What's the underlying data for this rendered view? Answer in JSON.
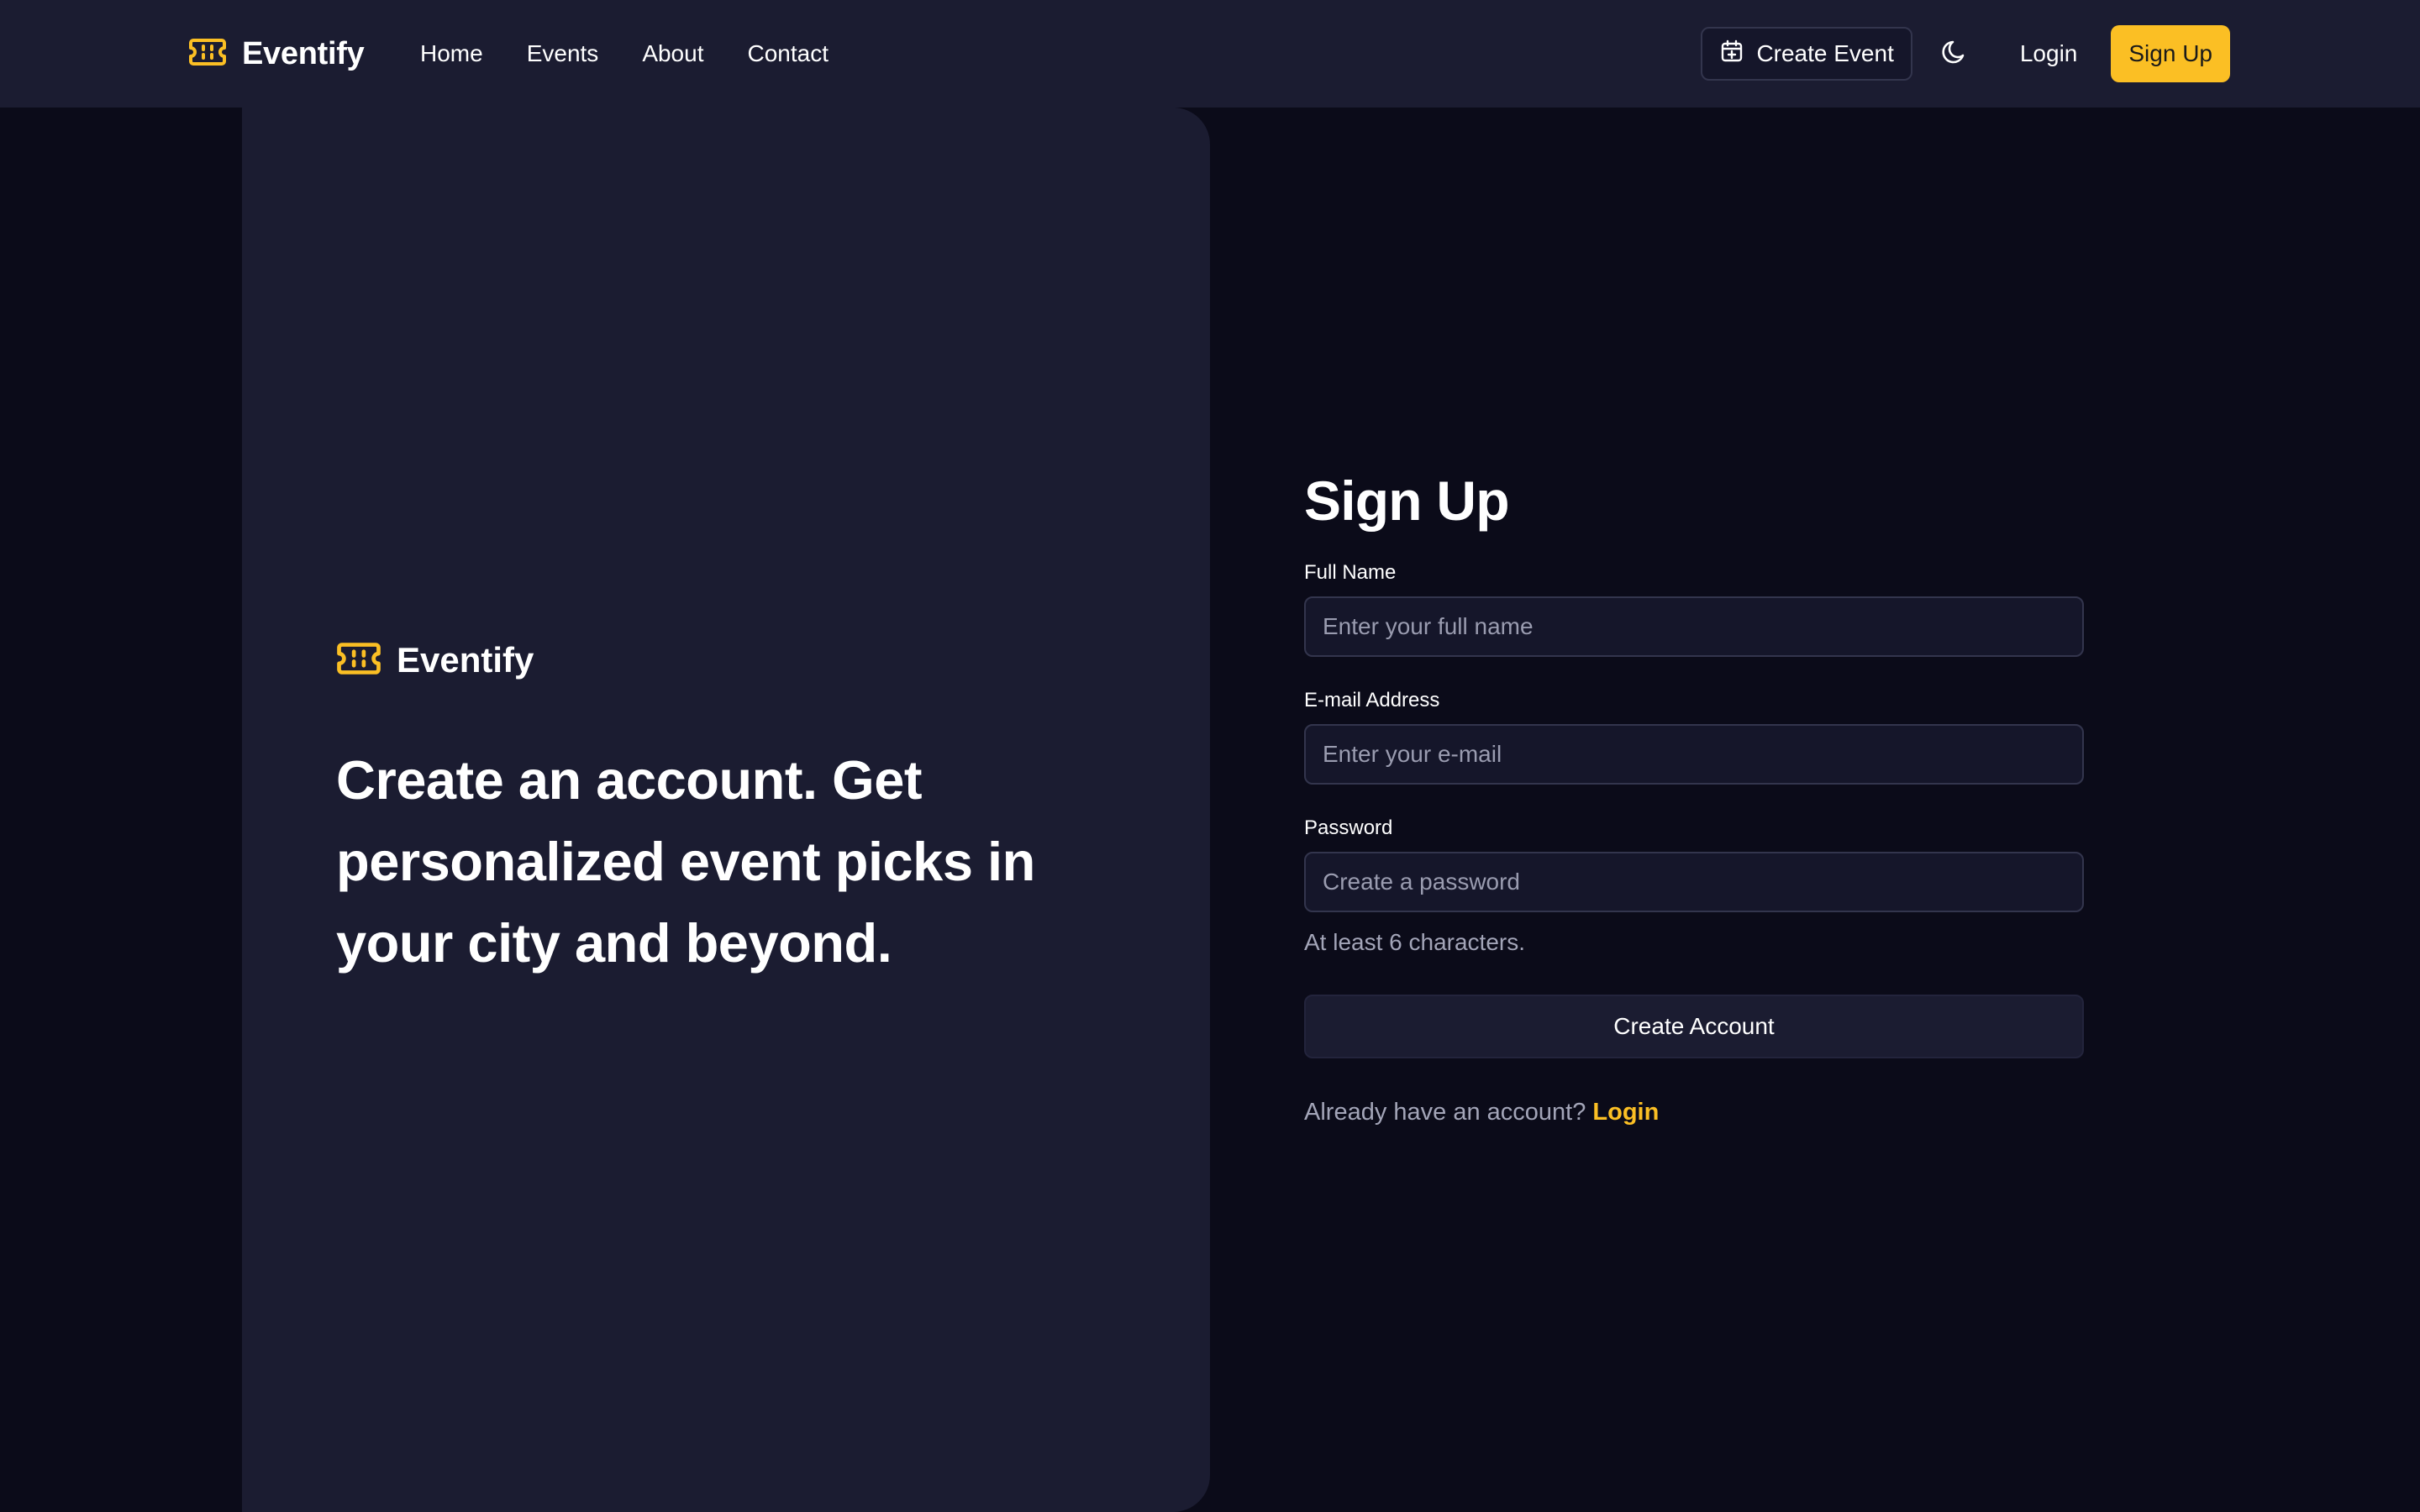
{
  "brand": {
    "name": "Eventify",
    "icon": "ticket-icon",
    "accent_color": "#fbbf24"
  },
  "nav": {
    "links": [
      "Home",
      "Events",
      "About",
      "Contact"
    ],
    "create_event_label": "Create Event",
    "create_event_icon": "calendar-plus-icon",
    "theme_toggle_icon": "moon-icon",
    "login_label": "Login",
    "signup_label": "Sign Up"
  },
  "hero": {
    "brand_name": "Eventify",
    "headline": "Create an account. Get personalized event picks in your city and beyond."
  },
  "form": {
    "title": "Sign Up",
    "full_name": {
      "label": "Full Name",
      "placeholder": "Enter your full name",
      "value": ""
    },
    "email": {
      "label": "E-mail Address",
      "placeholder": "Enter your e-mail",
      "value": ""
    },
    "password": {
      "label": "Password",
      "placeholder": "Create a password",
      "value": "",
      "hint": "At least 6 characters."
    },
    "submit_label": "Create Account",
    "login_prompt": "Already have an account?",
    "login_link": "Login"
  },
  "colors": {
    "page_background": "#0b0b19",
    "panel_background": "#1b1c31",
    "accent": "#fbbf24",
    "muted_text": "#a3a5b8"
  }
}
